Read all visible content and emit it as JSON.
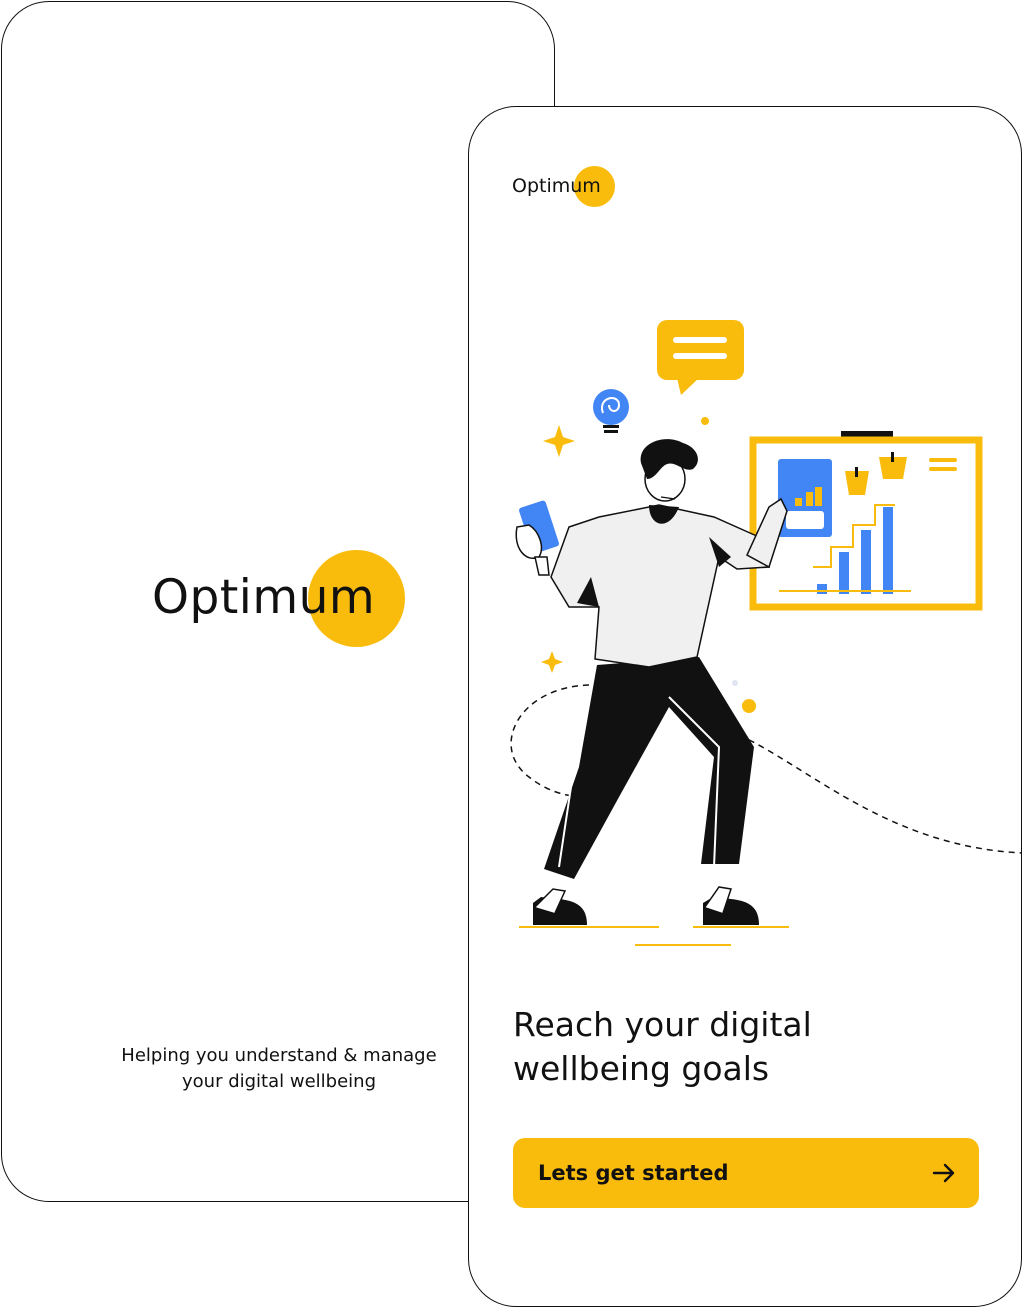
{
  "colors": {
    "accent": "#F9BC0D",
    "blue": "#4285F4",
    "text": "#111111",
    "outline": "#111111"
  },
  "splash": {
    "logo_text": "Optimum",
    "tagline_line1": "Helping you understand & manage",
    "tagline_line2": "your digital wellbeing"
  },
  "onboarding": {
    "logo_text": "Optimum",
    "illustration_icon": "person-presenting-chart-illustration",
    "headline_line1": "Reach your digital",
    "headline_line2": "wellbeing goals",
    "cta_label": "Lets get started",
    "cta_icon": "arrow-right-icon"
  }
}
